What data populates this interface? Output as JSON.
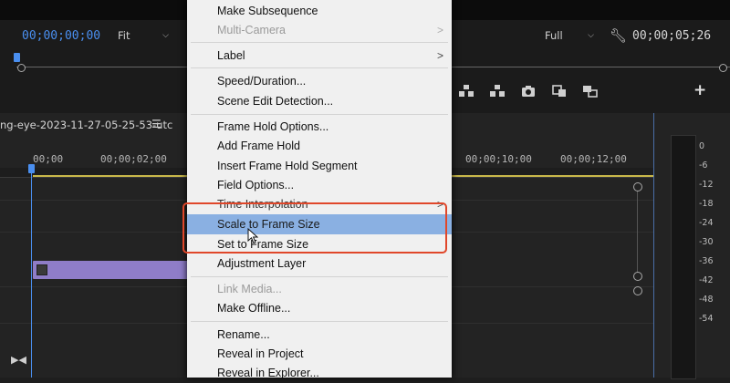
{
  "monitor": {
    "timecode_left": "00;00;00;00",
    "fit_label": "Fit",
    "quality_label": "Full",
    "timecode_right": "00;00;05;26"
  },
  "timeline": {
    "sequence_name": "ng-eye-2023-11-27-05-25-53-utc",
    "ruler": [
      "00;00",
      "00;00;02;00",
      "00;00;10;00",
      "00;00;12;00"
    ],
    "meter_labels": [
      "0",
      "-6",
      "-12",
      "-18",
      "-24",
      "-30",
      "-36",
      "-42",
      "-48",
      "-54"
    ]
  },
  "menu": {
    "items": [
      {
        "label": "Make Subsequence",
        "state": "normal"
      },
      {
        "label": "Multi-Camera",
        "state": "disabled",
        "submenu": ">"
      },
      {
        "label": "Label",
        "state": "normal",
        "submenu": ">"
      },
      {
        "label": "Speed/Duration...",
        "state": "normal"
      },
      {
        "label": "Scene Edit Detection...",
        "state": "normal"
      },
      {
        "label": "Frame Hold Options...",
        "state": "normal"
      },
      {
        "label": "Add Frame Hold",
        "state": "normal"
      },
      {
        "label": "Insert Frame Hold Segment",
        "state": "normal"
      },
      {
        "label": "Field Options...",
        "state": "normal"
      },
      {
        "label": "Time Interpolation",
        "state": "normal",
        "submenu": ">"
      },
      {
        "label": "Scale to Frame Size",
        "state": "highlighted"
      },
      {
        "label": "Set to Frame Size",
        "state": "normal"
      },
      {
        "label": "Adjustment Layer",
        "state": "normal"
      },
      {
        "label": "Link Media...",
        "state": "disabled"
      },
      {
        "label": "Make Offline...",
        "state": "normal"
      },
      {
        "label": "Rename...",
        "state": "normal"
      },
      {
        "label": "Reveal in Project",
        "state": "normal"
      },
      {
        "label": "Reveal in Explorer...",
        "state": "normal"
      }
    ]
  },
  "colors": {
    "accent_blue": "#4a8ff0",
    "menu_highlight": "#8ab0e2",
    "annotation_red": "#e0472a",
    "clip_purple": "#8f7dc8"
  }
}
